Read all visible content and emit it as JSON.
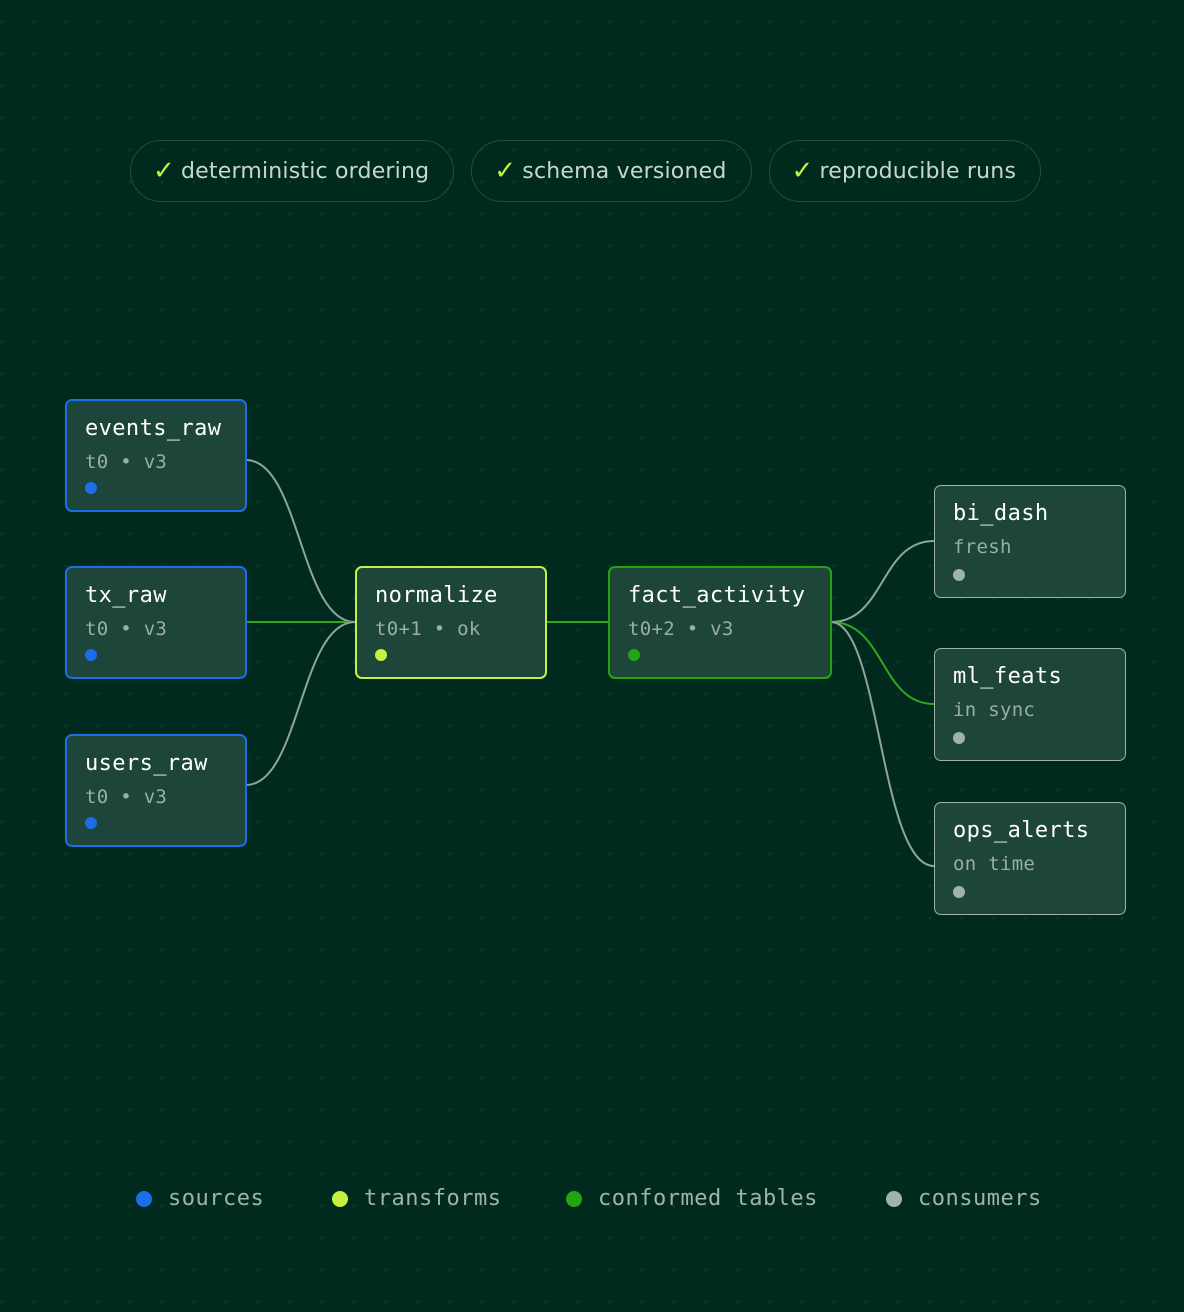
{
  "badges": [
    {
      "check": "✓",
      "label": "deterministic ordering"
    },
    {
      "check": "✓",
      "label": "schema versioned"
    },
    {
      "check": "✓",
      "label": "reproducible runs"
    }
  ],
  "nodes": {
    "events_raw": {
      "title": "events_raw",
      "meta": "t0 • v3",
      "group": "sources"
    },
    "tx_raw": {
      "title": "tx_raw",
      "meta": "t0 • v3",
      "group": "sources"
    },
    "users_raw": {
      "title": "users_raw",
      "meta": "t0 • v3",
      "group": "sources"
    },
    "normalize": {
      "title": "normalize",
      "meta": "t0+1 • ok",
      "group": "transforms"
    },
    "fact_activity": {
      "title": "fact_activity",
      "meta": "t0+2 • v3",
      "group": "conformed tables"
    },
    "bi_dash": {
      "title": "bi_dash",
      "meta": "fresh",
      "group": "consumers"
    },
    "ml_feats": {
      "title": "ml_feats",
      "meta": "in sync",
      "group": "consumers"
    },
    "ops_alerts": {
      "title": "ops_alerts",
      "meta": "on time",
      "group": "consumers"
    }
  },
  "edges": [
    {
      "from": "events_raw",
      "to": "normalize",
      "active": false
    },
    {
      "from": "tx_raw",
      "to": "normalize",
      "active": true
    },
    {
      "from": "users_raw",
      "to": "normalize",
      "active": false
    },
    {
      "from": "normalize",
      "to": "fact_activity",
      "active": true
    },
    {
      "from": "fact_activity",
      "to": "bi_dash",
      "active": false
    },
    {
      "from": "fact_activity",
      "to": "ml_feats",
      "active": true
    },
    {
      "from": "fact_activity",
      "to": "ops_alerts",
      "active": false
    }
  ],
  "legend": [
    {
      "label": "sources",
      "color": "#1a6fe8"
    },
    {
      "label": "transforms",
      "color": "#c4f23c"
    },
    {
      "label": "conformed tables",
      "color": "#23a511"
    },
    {
      "label": "consumers",
      "color": "#9eb4a8"
    }
  ],
  "colors": {
    "background": "#012a1f",
    "sources": "#1a6fe8",
    "transforms": "#c4f23c",
    "conformed": "#23a511",
    "consumers": "#9eb4a8",
    "edge_active": "#2fa81b",
    "edge_inactive": "#8fa49a"
  }
}
